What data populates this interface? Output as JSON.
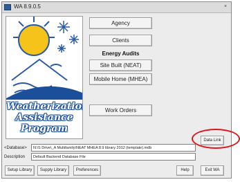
{
  "window": {
    "title": "WA 8.9.0.5",
    "close_symbol": "×"
  },
  "logo": {
    "lines": [
      "Weatherization",
      "Assistance",
      "Program"
    ]
  },
  "menu": {
    "agency": "Agency",
    "clients": "Clients",
    "energy_audits_heading": "Energy Audits",
    "site_built": "Site Built (NEAT)",
    "mobile_home": "Mobile Home (MHEA)",
    "work_orders": "Work Orders"
  },
  "database": {
    "database_label": "<Database>",
    "database_path": "N:\\S Drive\\_A Multifamily\\NEAT MHEA 8.9 library 2012 (template).mdb",
    "description_label": "Description",
    "description_value": "Default Backend Database File",
    "data_link_button": "Data Link"
  },
  "bottom_bar": {
    "setup_library": "Setup Library",
    "supply_library": "Supply Library",
    "preferences": "Preferences",
    "help": "Help",
    "exit": "Exit WA"
  },
  "colors": {
    "highlight": "#e0161d",
    "logo_text": "#ffffff",
    "logo_outline": "#1c4f9a"
  }
}
